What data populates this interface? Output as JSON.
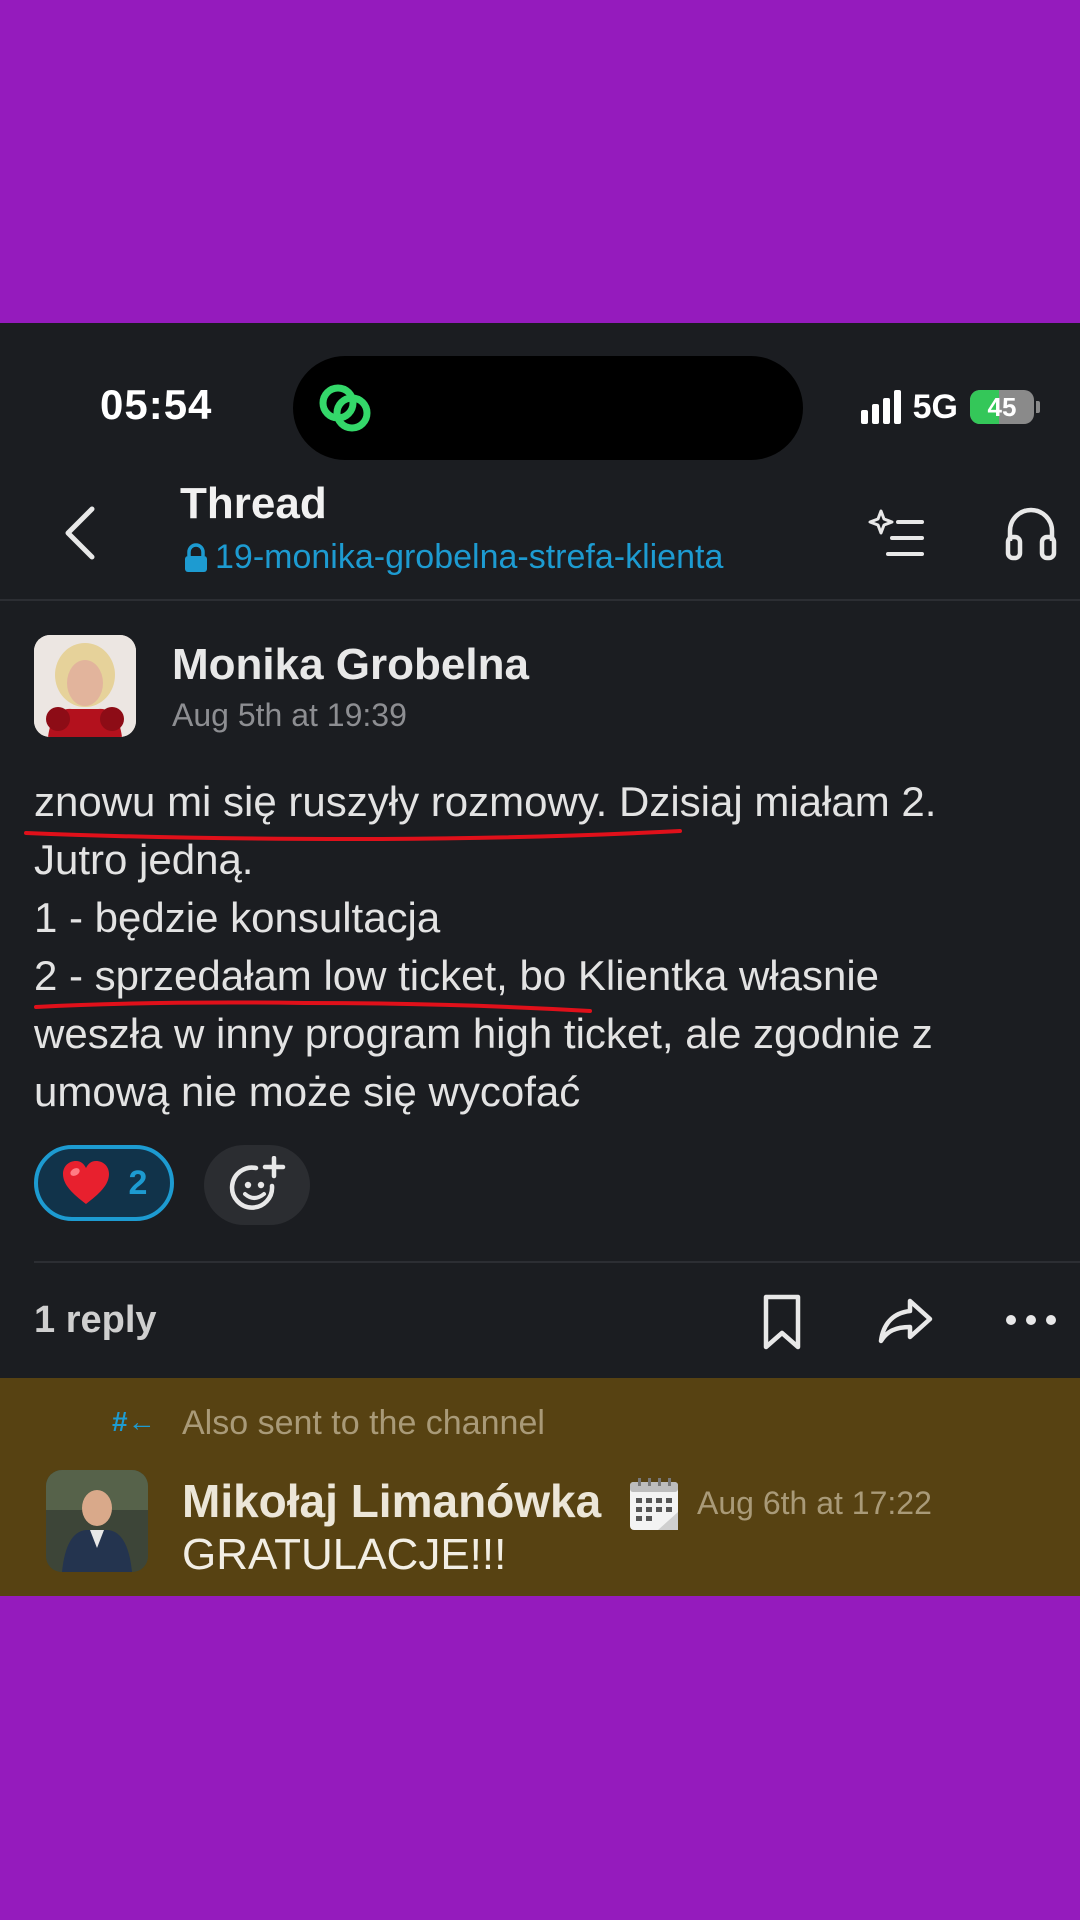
{
  "status_bar": {
    "time": "05:54",
    "network": "5G",
    "battery": "45",
    "battery_level": 0.45,
    "island_icon": "link-rings-icon"
  },
  "header": {
    "back_icon": "chevron-left-icon",
    "title": "Thread",
    "channel": "19-monika-grobelna-strefa-klienta",
    "channel_icon": "lock-icon",
    "actions": [
      "sparkle-list-icon",
      "headphones-icon"
    ]
  },
  "message": {
    "author": "Monika Grobelna",
    "timestamp": "Aug 5th at 19:39",
    "lines": [
      "znowu mi się ruszyły rozmowy. Dzisiaj miałam 2.",
      "Jutro jedną.",
      "1 - będzie konsultacja",
      "2 - sprzedałam low ticket, bo Klientka własnie",
      "weszła w inny program high ticket, ale zgodnie z",
      "umową nie może się wycofać"
    ],
    "reactions": [
      {
        "emoji": "❤️",
        "icon": "heart-icon",
        "count": "2"
      }
    ],
    "add_reaction_icon": "add-reaction-icon"
  },
  "thread_bar": {
    "reply_count": "1 reply",
    "actions": [
      "bookmark-icon",
      "share-icon",
      "more-icon"
    ]
  },
  "reply": {
    "also_sent_icon": "#←",
    "also_sent": "Also sent to the channel",
    "author": "Mikołaj Limanówka",
    "author_status_icon": "calendar-icon",
    "timestamp": "Aug 6th at 17:22",
    "text": "GRATULACJE!!!"
  },
  "colors": {
    "background": "#951bbd",
    "app_bg": "#1b1d21",
    "link": "#1d9bd1",
    "highlight": "#574212",
    "annotation": "#e0101a"
  }
}
